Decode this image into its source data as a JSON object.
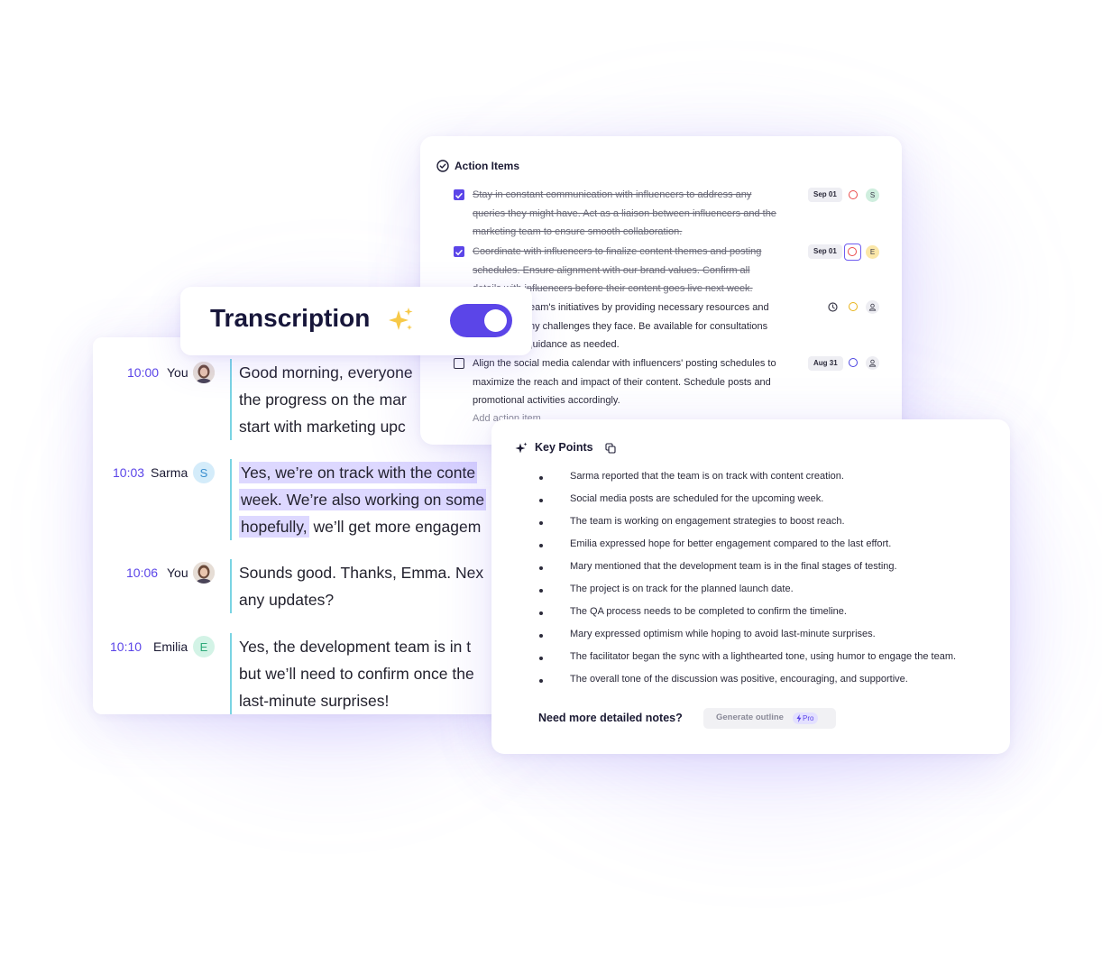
{
  "transcription": {
    "title": "Transcription",
    "toggle_on": true
  },
  "transcript": [
    {
      "time": "10:00",
      "name": "You",
      "avatar": "photo",
      "lines": [
        "Good morning, everyone",
        "the progress on the mar",
        "start with marketing upc"
      ]
    },
    {
      "time": "10:03",
      "name": "Sarma",
      "avatar": "S",
      "lines": [
        "Yes, we’re on track with the conte",
        "week. We’re also working on some",
        "hopefully,",
        " we’ll get more engagem"
      ]
    },
    {
      "time": "10:06",
      "name": "You",
      "avatar": "photo",
      "lines": [
        "Sounds good. Thanks, Emma. Nex",
        "any updates?"
      ]
    },
    {
      "time": "10:10",
      "name": "Emilia",
      "avatar": "E",
      "lines": [
        "Yes, the development team is in t",
        "but we’ll need to confirm once the",
        "last-minute surprises!"
      ]
    }
  ],
  "action_items": {
    "title": "Action Items",
    "items": [
      {
        "done": true,
        "lines": [
          "Stay in constant communication with influencers to address any",
          "queries they might have. Act as a liaison between influencers and the",
          "marketing team to ensure smooth collaboration."
        ],
        "date": "Sep 01",
        "assignee": "S"
      },
      {
        "done": true,
        "lines": [
          "Coordinate with influencers to finalize content themes and posting",
          "schedules. Ensure alignment with our brand values. Confirm all",
          "details with influencers before their content goes live next week."
        ],
        "date": "Sep 01",
        "assignee": "E"
      },
      {
        "done": false,
        "lines": [
          "Support the team's initiatives by providing necessary resources and",
          "addressing any challenges they face. Be available for consultations",
          "and provide guidance as needed."
        ],
        "date": "",
        "assignee": ""
      },
      {
        "done": false,
        "lines": [
          "Align the social media calendar with influencers' posting schedules to",
          "maximize the reach and impact of their content. Schedule posts and",
          "promotional activities accordingly."
        ],
        "date": "Aug 31",
        "assignee": ""
      }
    ],
    "add_label": "Add action item"
  },
  "key_points": {
    "title": "Key Points",
    "items": [
      "Sarma reported that the team is on track with content creation.",
      "Social media posts are scheduled for the upcoming week.",
      "The team is working on engagement strategies to boost reach.",
      "Emilia expressed hope for better engagement compared to the last effort.",
      "Mary mentioned that the development team is in the final stages of testing.",
      "The project is on track for the planned launch date.",
      "The QA process needs to be completed to confirm the timeline.",
      "Mary expressed optimism while hoping to avoid last-minute surprises.",
      "The facilitator began the sync with a lighthearted tone, using humor to engage the team.",
      "The overall tone of the discussion was positive, encouraging, and supportive."
    ],
    "need_more": "Need more detailed notes?",
    "generate_label": "Generate outline",
    "pro_label": "Pro"
  }
}
